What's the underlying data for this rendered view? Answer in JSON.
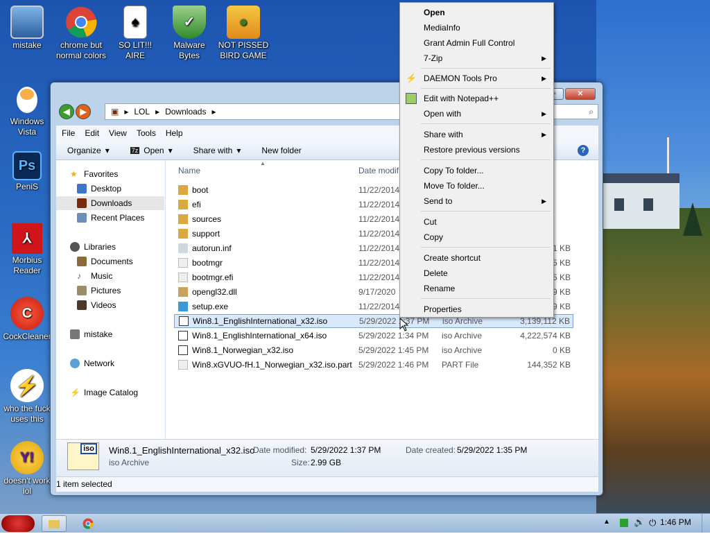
{
  "desktop": {
    "icons": [
      {
        "label": "mistake"
      },
      {
        "label": "chrome but normal colors"
      },
      {
        "label": "SO LIT!!! AIRE"
      },
      {
        "label": "Malware Bytes"
      },
      {
        "label": "NOT PISSED BIRD GAME"
      },
      {
        "label": "Windows Vista"
      },
      {
        "label": "PeniS"
      },
      {
        "label": "Morbius Reader"
      },
      {
        "label": "CockCleaner"
      },
      {
        "label": "who the fuck uses this"
      },
      {
        "label": "doesn't work lol"
      }
    ]
  },
  "explorer": {
    "breadcrumb": [
      "LOL",
      "Downloads"
    ],
    "menu": [
      "File",
      "Edit",
      "View",
      "Tools",
      "Help"
    ],
    "toolbar": {
      "organize": "Organize",
      "open": "Open",
      "share_with": "Share with",
      "new_folder": "New folder"
    },
    "nav": {
      "favorites": "Favorites",
      "desktop": "Desktop",
      "downloads": "Downloads",
      "recent_places": "Recent Places",
      "libraries": "Libraries",
      "documents": "Documents",
      "music": "Music",
      "pictures": "Pictures",
      "videos": "Videos",
      "homegroup": "mistake",
      "network": "Network",
      "image_catalog": "Image Catalog"
    },
    "columns": {
      "name": "Name",
      "date": "Date modif"
    },
    "files": [
      {
        "name": "boot",
        "date": "11/22/2014",
        "type": "",
        "size": ""
      },
      {
        "name": "efi",
        "date": "11/22/2014",
        "type": "",
        "size": ""
      },
      {
        "name": "sources",
        "date": "11/22/2014",
        "type": "",
        "size": ""
      },
      {
        "name": "support",
        "date": "11/22/2014",
        "type": "",
        "size": ""
      },
      {
        "name": "autorun.inf",
        "date": "11/22/2014",
        "type": "",
        "size": "1 KB"
      },
      {
        "name": "bootmgr",
        "date": "11/22/2014",
        "type": "",
        "size": "5 KB"
      },
      {
        "name": "bootmgr.efi",
        "date": "11/22/2014",
        "type": "",
        "size": "5 KB"
      },
      {
        "name": "opengl32.dll",
        "date": "9/17/2020",
        "type": "",
        "size": "9 KB"
      },
      {
        "name": "setup.exe",
        "date": "11/22/2014",
        "type": "",
        "size": "9 KB"
      },
      {
        "name": "Win8.1_EnglishInternational_x32.iso",
        "date": "5/29/2022 1:37 PM",
        "type": "iso Archive",
        "size": "3,139,112 KB"
      },
      {
        "name": "Win8.1_EnglishInternational_x64.iso",
        "date": "5/29/2022 1:34 PM",
        "type": "iso Archive",
        "size": "4,222,574 KB"
      },
      {
        "name": "Win8.1_Norwegian_x32.iso",
        "date": "5/29/2022 1:45 PM",
        "type": "iso Archive",
        "size": "0 KB"
      },
      {
        "name": "Win8.xGVUO-fH.1_Norwegian_x32.iso.part",
        "date": "5/29/2022 1:46 PM",
        "type": "PART File",
        "size": "144,352 KB"
      }
    ],
    "details": {
      "filename": "Win8.1_EnglishInternational_x32.iso",
      "type": "iso Archive",
      "modified_label": "Date modified:",
      "modified_value": "5/29/2022 1:37 PM",
      "created_label": "Date created:",
      "created_value": "5/29/2022 1:35 PM",
      "size_label": "Size:",
      "size_value": "2.99 GB",
      "badge": "iso"
    },
    "status": "1 item selected"
  },
  "context_menu": {
    "open": "Open",
    "mediainfo": "MediaInfo",
    "grant_admin": "Grant Admin Full Control",
    "zip": "7-Zip",
    "daemon": "DAEMON Tools Pro",
    "notepad": "Edit with Notepad++",
    "open_with": "Open with",
    "share_with": "Share with",
    "restore": "Restore previous versions",
    "copy_to": "Copy To folder...",
    "move_to": "Move To folder...",
    "send_to": "Send to",
    "cut": "Cut",
    "copy": "Copy",
    "create_shortcut": "Create shortcut",
    "delete": "Delete",
    "rename": "Rename",
    "properties": "Properties"
  },
  "taskbar": {
    "clock": "1:46 PM"
  }
}
